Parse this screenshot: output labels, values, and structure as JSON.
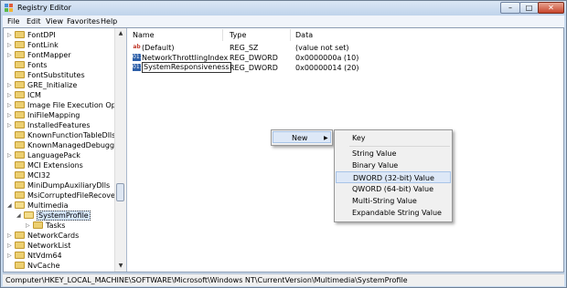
{
  "window": {
    "title": "Registry Editor",
    "btn_min": "–",
    "btn_max": "□",
    "btn_close": "✕"
  },
  "menu": [
    "File",
    "Edit",
    "View",
    "Favorites",
    "Help"
  ],
  "tree": [
    {
      "label": "FontDPI",
      "expander": "▷"
    },
    {
      "label": "FontLink",
      "expander": "▷"
    },
    {
      "label": "FontMapper",
      "expander": "▷"
    },
    {
      "label": "Fonts",
      "expander": ""
    },
    {
      "label": "FontSubstitutes",
      "expander": ""
    },
    {
      "label": "GRE_Initialize",
      "expander": "▷"
    },
    {
      "label": "ICM",
      "expander": "▷"
    },
    {
      "label": "Image File Execution Options",
      "expander": "▷"
    },
    {
      "label": "IniFileMapping",
      "expander": "▷"
    },
    {
      "label": "InstalledFeatures",
      "expander": "▷"
    },
    {
      "label": "KnownFunctionTableDlls",
      "expander": ""
    },
    {
      "label": "KnownManagedDebuggingDll",
      "expander": ""
    },
    {
      "label": "LanguagePack",
      "expander": "▷"
    },
    {
      "label": "MCI Extensions",
      "expander": ""
    },
    {
      "label": "MCI32",
      "expander": ""
    },
    {
      "label": "MiniDumpAuxiliaryDlls",
      "expander": ""
    },
    {
      "label": "MsiCorruptedFileRecovery",
      "expander": ""
    },
    {
      "label": "Multimedia",
      "expander": "◢"
    },
    {
      "label": "SystemProfile",
      "expander": "◢"
    },
    {
      "label": "Tasks",
      "expander": "▷"
    },
    {
      "label": "NetworkCards",
      "expander": "▷"
    },
    {
      "label": "NetworkList",
      "expander": "▷"
    },
    {
      "label": "NtVdm64",
      "expander": "▷"
    },
    {
      "label": "NvCache",
      "expander": ""
    }
  ],
  "list": {
    "headers": {
      "name": "Name",
      "type": "Type",
      "data": "Data"
    },
    "rows": [
      {
        "icon": "ab",
        "name": "(Default)",
        "type": "REG_SZ",
        "data": "(value not set)"
      },
      {
        "icon": "011",
        "name": "NetworkThrottlingIndex",
        "type": "REG_DWORD",
        "data": "0x0000000a (10)"
      },
      {
        "icon": "011",
        "name": "SystemResponsiveness",
        "type": "REG_DWORD",
        "data": "0x00000014 (20)"
      }
    ]
  },
  "context_menu": {
    "label": "New",
    "arrow": "▶"
  },
  "submenu": [
    "Key",
    "String Value",
    "Binary Value",
    "DWORD (32-bit) Value",
    "QWORD (64-bit) Value",
    "Multi-String Value",
    "Expandable String Value"
  ],
  "status": "Computer\\HKEY_LOCAL_MACHINE\\SOFTWARE\\Microsoft\\Windows NT\\CurrentVersion\\Multimedia\\SystemProfile",
  "colors": {
    "title_bar": "#c9dbef",
    "highlight": "#dde8f7",
    "close_button": "#c7452c"
  }
}
